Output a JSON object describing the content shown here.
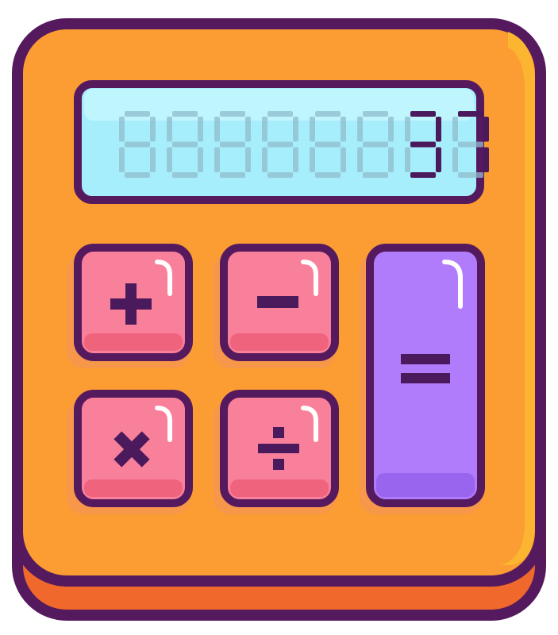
{
  "display": {
    "value": "37",
    "digits": 8,
    "lit_color": "#4a1a5c",
    "unlit_color": "#8fbccc",
    "screen_color": "#a7eefc"
  },
  "keys": [
    {
      "id": "add",
      "symbol": "plus-icon",
      "label": "+"
    },
    {
      "id": "subtract",
      "symbol": "minus-icon",
      "label": "−"
    },
    {
      "id": "multiply",
      "symbol": "multiply-icon",
      "label": "×"
    },
    {
      "id": "divide",
      "symbol": "divide-icon",
      "label": "÷"
    },
    {
      "id": "equals",
      "symbol": "equals-icon",
      "label": "="
    }
  ],
  "colors": {
    "outline": "#551a5e",
    "body": "#fc9d33",
    "body_highlight": "#fbb531",
    "body_bottom": "#f0682b",
    "op_key": "#f9809a",
    "op_key_shade": "#f0637d",
    "equals_key": "#b07cfb",
    "equals_key_shade": "#9a65ee",
    "glint": "#ffffff"
  }
}
